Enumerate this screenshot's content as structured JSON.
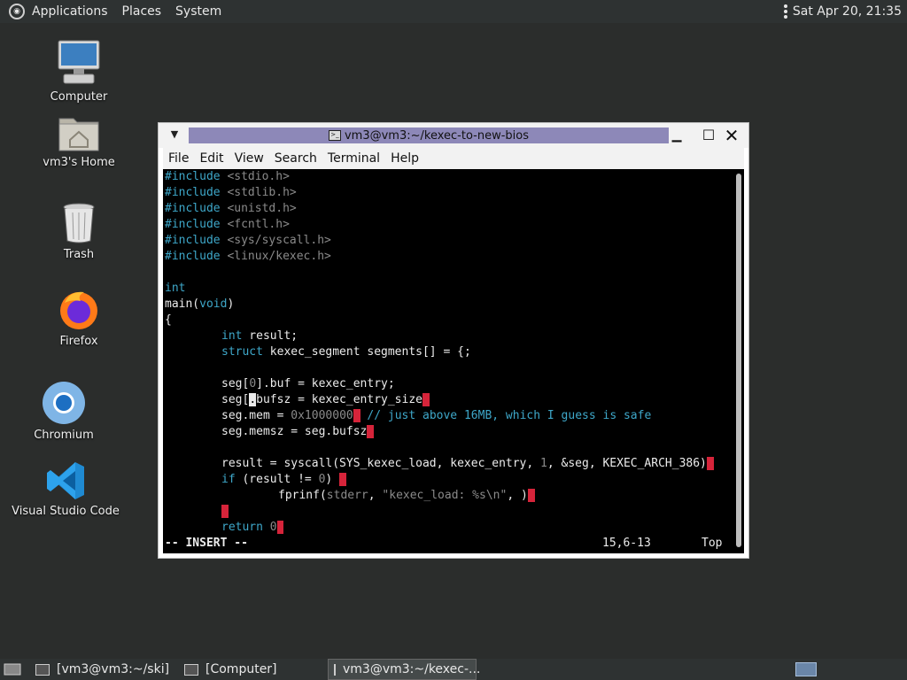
{
  "top_panel": {
    "applications": "Applications",
    "places": "Places",
    "system": "System",
    "clock": "Sat Apr 20, 21:35"
  },
  "desktop": {
    "computer": "Computer",
    "home": "vm3's Home",
    "trash": "Trash",
    "firefox": "Firefox",
    "chromium": "Chromium",
    "vscode": "Visual Studio Code"
  },
  "window": {
    "title": "vm3@vm3:~/kexec-to-new-bios",
    "menu": [
      "File",
      "Edit",
      "View",
      "Search",
      "Terminal",
      "Help"
    ]
  },
  "editor": {
    "l1_kw": "#include",
    "l1_h": " <stdio.h>",
    "l2_kw": "#include",
    "l2_h": " <stdlib.h>",
    "l3_kw": "#include",
    "l3_h": " <unistd.h>",
    "l4_kw": "#include",
    "l4_h": " <fcntl.h>",
    "l5_kw": "#include",
    "l5_h": " <sys/syscall.h>",
    "l6_kw": "#include",
    "l6_h": " <linux/kexec.h>",
    "l8": "int",
    "l9a": "main(",
    "l9b": "void",
    "l9c": ")",
    "l10": "{",
    "l11_kw": "int",
    "l11_rest": " result;",
    "l12_kw": "struct",
    "l12_rest": " kexec_segment segments[] = {;",
    "l14a": "seg[",
    "l14b": "0",
    "l14c": "].buf = kexec_entry;",
    "l15a": "seg[",
    "l15cur": ".",
    "l15c": "bufsz = kexec_entry_size",
    "l16a": "seg.mem = ",
    "l16b": "0x1000000",
    "l16c": " // just above 16MB, which I guess is safe",
    "l17a": "seg.memsz = seg.bufsz",
    "l19a": "result = syscall(SYS_kexec_load, kexec_entry, ",
    "l19b": "1",
    "l19c": ", &seg, KEXEC_ARCH_386)",
    "l20kw": "if",
    "l20a": " (result != ",
    "l20b": "0",
    "l20c": ") ",
    "l21a": "fprinf(",
    "l21b": "stderr",
    "l21c": ", ",
    "l21d": "\"kexec_load: %s\\n\"",
    "l21e": ", )",
    "l23kw": "return",
    "l23b": " 0",
    "semi": ";",
    "brace_open": "{",
    "brace_close": "}",
    "mode": "-- INSERT --",
    "pos": "15,6-13",
    "scroll": "Top"
  },
  "taskbar": {
    "item1": "[vm3@vm3:~/ski]",
    "item2": "[Computer]",
    "item3": "vm3@vm3:~/kexec-..."
  }
}
